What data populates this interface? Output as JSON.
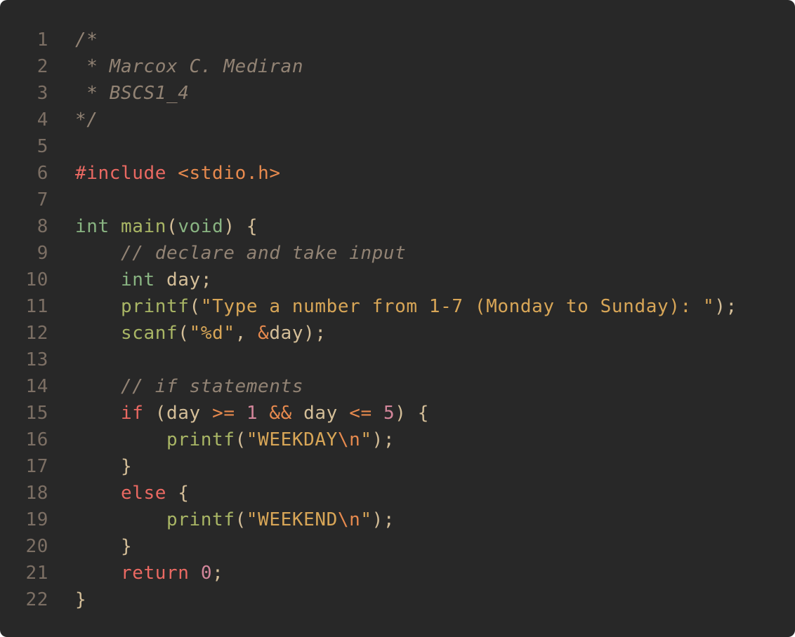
{
  "editor": {
    "background": "#282828",
    "colors": {
      "comment": "#928374",
      "preproc": "#ea6962",
      "header": "#e78a4e",
      "type": "#89b482",
      "func": "#a9b665",
      "keyword": "#ea6962",
      "string": "#d8a657",
      "escape": "#e78a4e",
      "number": "#d3869b",
      "operator": "#e78a4e",
      "plain": "#d4be98",
      "line_number": "#7c6f64"
    },
    "lines": [
      {
        "n": "1",
        "tokens": [
          {
            "t": "comment",
            "v": "/*"
          }
        ]
      },
      {
        "n": "2",
        "tokens": [
          {
            "t": "comment",
            "v": " * Marcox C. Mediran"
          }
        ]
      },
      {
        "n": "3",
        "tokens": [
          {
            "t": "comment",
            "v": " * BSCS1_4"
          }
        ]
      },
      {
        "n": "4",
        "tokens": [
          {
            "t": "comment",
            "v": "*/"
          }
        ]
      },
      {
        "n": "5",
        "tokens": []
      },
      {
        "n": "6",
        "tokens": [
          {
            "t": "preproc",
            "v": "#include"
          },
          {
            "t": "ws",
            "v": " "
          },
          {
            "t": "header",
            "v": "<stdio.h>"
          }
        ]
      },
      {
        "n": "7",
        "tokens": []
      },
      {
        "n": "8",
        "tokens": [
          {
            "t": "type",
            "v": "int"
          },
          {
            "t": "ws",
            "v": " "
          },
          {
            "t": "func",
            "v": "main"
          },
          {
            "t": "punct",
            "v": "("
          },
          {
            "t": "type",
            "v": "void"
          },
          {
            "t": "punct",
            "v": ") {"
          }
        ]
      },
      {
        "n": "9",
        "tokens": [
          {
            "t": "ws",
            "v": "    "
          },
          {
            "t": "comment",
            "v": "// declare and take input"
          }
        ]
      },
      {
        "n": "10",
        "tokens": [
          {
            "t": "ws",
            "v": "    "
          },
          {
            "t": "type",
            "v": "int"
          },
          {
            "t": "ws",
            "v": " "
          },
          {
            "t": "var",
            "v": "day"
          },
          {
            "t": "punct",
            "v": ";"
          }
        ]
      },
      {
        "n": "11",
        "tokens": [
          {
            "t": "ws",
            "v": "    "
          },
          {
            "t": "func",
            "v": "printf"
          },
          {
            "t": "punct",
            "v": "("
          },
          {
            "t": "string",
            "v": "\"Type a number from 1-7 (Monday to Sunday): \""
          },
          {
            "t": "punct",
            "v": ");"
          }
        ]
      },
      {
        "n": "12",
        "tokens": [
          {
            "t": "ws",
            "v": "    "
          },
          {
            "t": "func",
            "v": "scanf"
          },
          {
            "t": "punct",
            "v": "("
          },
          {
            "t": "string",
            "v": "\"%d\""
          },
          {
            "t": "punct",
            "v": ", "
          },
          {
            "t": "op",
            "v": "&"
          },
          {
            "t": "var",
            "v": "day"
          },
          {
            "t": "punct",
            "v": ");"
          }
        ]
      },
      {
        "n": "13",
        "tokens": []
      },
      {
        "n": "14",
        "tokens": [
          {
            "t": "ws",
            "v": "    "
          },
          {
            "t": "comment",
            "v": "// if statements"
          }
        ]
      },
      {
        "n": "15",
        "tokens": [
          {
            "t": "ws",
            "v": "    "
          },
          {
            "t": "kw",
            "v": "if"
          },
          {
            "t": "punct",
            "v": " ("
          },
          {
            "t": "var",
            "v": "day"
          },
          {
            "t": "ws",
            "v": " "
          },
          {
            "t": "op",
            "v": ">="
          },
          {
            "t": "ws",
            "v": " "
          },
          {
            "t": "num",
            "v": "1"
          },
          {
            "t": "ws",
            "v": " "
          },
          {
            "t": "op",
            "v": "&&"
          },
          {
            "t": "ws",
            "v": " "
          },
          {
            "t": "var",
            "v": "day"
          },
          {
            "t": "ws",
            "v": " "
          },
          {
            "t": "op",
            "v": "<="
          },
          {
            "t": "ws",
            "v": " "
          },
          {
            "t": "num",
            "v": "5"
          },
          {
            "t": "punct",
            "v": ") {"
          }
        ]
      },
      {
        "n": "16",
        "tokens": [
          {
            "t": "ws",
            "v": "        "
          },
          {
            "t": "func",
            "v": "printf"
          },
          {
            "t": "punct",
            "v": "("
          },
          {
            "t": "string",
            "v": "\"WEEKDAY"
          },
          {
            "t": "escape",
            "v": "\\n"
          },
          {
            "t": "string",
            "v": "\""
          },
          {
            "t": "punct",
            "v": ");"
          }
        ]
      },
      {
        "n": "17",
        "tokens": [
          {
            "t": "ws",
            "v": "    "
          },
          {
            "t": "punct",
            "v": "}"
          }
        ]
      },
      {
        "n": "18",
        "tokens": [
          {
            "t": "ws",
            "v": "    "
          },
          {
            "t": "kw",
            "v": "else"
          },
          {
            "t": "punct",
            "v": " {"
          }
        ]
      },
      {
        "n": "19",
        "tokens": [
          {
            "t": "ws",
            "v": "        "
          },
          {
            "t": "func",
            "v": "printf"
          },
          {
            "t": "punct",
            "v": "("
          },
          {
            "t": "string",
            "v": "\"WEEKEND"
          },
          {
            "t": "escape",
            "v": "\\n"
          },
          {
            "t": "string",
            "v": "\""
          },
          {
            "t": "punct",
            "v": ");"
          }
        ]
      },
      {
        "n": "20",
        "tokens": [
          {
            "t": "ws",
            "v": "    "
          },
          {
            "t": "punct",
            "v": "}"
          }
        ]
      },
      {
        "n": "21",
        "tokens": [
          {
            "t": "ws",
            "v": "    "
          },
          {
            "t": "kw",
            "v": "return"
          },
          {
            "t": "ws",
            "v": " "
          },
          {
            "t": "num",
            "v": "0"
          },
          {
            "t": "punct",
            "v": ";"
          }
        ]
      },
      {
        "n": "22",
        "tokens": [
          {
            "t": "punct",
            "v": "}"
          }
        ]
      }
    ]
  }
}
